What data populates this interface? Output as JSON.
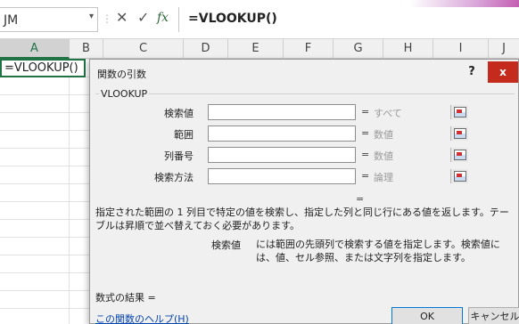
{
  "formula_bar": {
    "name_box": "JM",
    "name_box_arrow": "▾",
    "separator": "⋮",
    "cancel_symbol": "✕",
    "enter_symbol": "✓",
    "fx_symbol": "fx",
    "formula": "=VLOOKUP()"
  },
  "grid": {
    "columns": [
      "A",
      "B",
      "C",
      "D",
      "E",
      "F",
      "G",
      "H",
      "I",
      "J"
    ],
    "selected_column": "A",
    "active_cell_text": "=VLOOKUP()"
  },
  "dialog": {
    "title": "関数の引数",
    "help_label": "?",
    "close_label": "x",
    "function_name": "VLOOKUP",
    "arguments": [
      {
        "label": "検索値",
        "value": "",
        "equals": "=",
        "type": "すべて"
      },
      {
        "label": "範囲",
        "value": "",
        "equals": "=",
        "type": "数値"
      },
      {
        "label": "列番号",
        "value": "",
        "equals": "=",
        "type": "数値"
      },
      {
        "label": "検索方法",
        "value": "",
        "equals": "=",
        "type": "論理"
      }
    ],
    "result_equals": "=",
    "description": "指定された範囲の 1 列目で特定の値を検索し、指定した列と同じ行にある値を返します。テーブルは昇順で並べ替えておく必要があります。",
    "arg_help_name": "検索値",
    "arg_help_text": "には範囲の先頭列で検索する値を指定します。検索値には、値、セル参照、または文字列を指定します。",
    "formula_result_label": "数式の結果 =",
    "help_link": "この関数のヘルプ(H)",
    "ok_label": "OK",
    "cancel_label": "キャンセル"
  },
  "colors": {
    "excel_green": "#217346",
    "close_red": "#c42b1c",
    "link_blue": "#0645ad"
  }
}
